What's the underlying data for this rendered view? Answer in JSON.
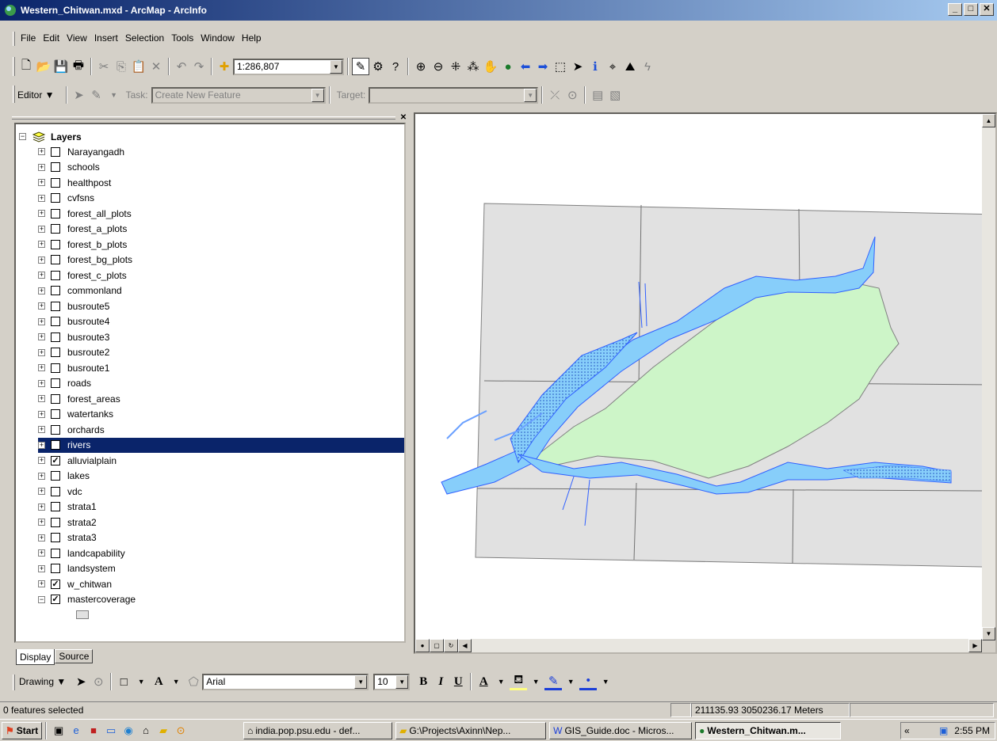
{
  "window": {
    "title": "Western_Chitwan.mxd - ArcMap - ArcInfo",
    "btn_min": "_",
    "btn_max": "□",
    "btn_close": "✕"
  },
  "menu": [
    "File",
    "Edit",
    "View",
    "Insert",
    "Selection",
    "Tools",
    "Window",
    "Help"
  ],
  "standard_toolbar": {
    "scale": "1:286,807"
  },
  "editor_toolbar": {
    "editor_label": "Editor ▼",
    "task_label": "Task:",
    "task_value": "Create New Feature",
    "target_label": "Target:",
    "target_value": ""
  },
  "toc": {
    "root": "Layers",
    "layers": [
      {
        "name": "Narayangadh",
        "checked": false
      },
      {
        "name": "schools",
        "checked": false
      },
      {
        "name": "healthpost",
        "checked": false
      },
      {
        "name": "cvfsns",
        "checked": false
      },
      {
        "name": "forest_all_plots",
        "checked": false
      },
      {
        "name": "forest_a_plots",
        "checked": false
      },
      {
        "name": "forest_b_plots",
        "checked": false
      },
      {
        "name": "forest_bg_plots",
        "checked": false
      },
      {
        "name": "forest_c_plots",
        "checked": false
      },
      {
        "name": "commonland",
        "checked": false
      },
      {
        "name": "busroute5",
        "checked": false
      },
      {
        "name": "busroute4",
        "checked": false
      },
      {
        "name": "busroute3",
        "checked": false
      },
      {
        "name": "busroute2",
        "checked": false
      },
      {
        "name": "busroute1",
        "checked": false
      },
      {
        "name": "roads",
        "checked": false
      },
      {
        "name": "forest_areas",
        "checked": false
      },
      {
        "name": "watertanks",
        "checked": false
      },
      {
        "name": "orchards",
        "checked": false
      },
      {
        "name": "rivers",
        "checked": true,
        "selected": true
      },
      {
        "name": "alluvialplain",
        "checked": true
      },
      {
        "name": "lakes",
        "checked": false
      },
      {
        "name": "vdc",
        "checked": false
      },
      {
        "name": "strata1",
        "checked": false
      },
      {
        "name": "strata2",
        "checked": false
      },
      {
        "name": "strata3",
        "checked": false
      },
      {
        "name": "landcapability",
        "checked": false
      },
      {
        "name": "landsystem",
        "checked": false
      },
      {
        "name": "w_chitwan",
        "checked": true
      },
      {
        "name": "mastercoverage",
        "checked": true,
        "expanded": true
      }
    ],
    "tabs": [
      "Display",
      "Source"
    ]
  },
  "drawing_toolbar": {
    "drawing_label": "Drawing ▼",
    "font": "Arial",
    "size": "10",
    "bold": "B",
    "italic": "I",
    "underline": "U",
    "font_color_label": "A"
  },
  "status": {
    "selected": "0 features selected",
    "coords": "211135.93  3050236.17 Meters"
  },
  "taskbar": {
    "start": "Start",
    "tasks": [
      "india.pop.psu.edu - def...",
      "G:\\Projects\\Axinn\\Nep...",
      "GIS_Guide.doc - Micros...",
      "Western_Chitwan.m..."
    ],
    "clock": "2:55 PM",
    "tray_chevron": "«"
  },
  "colors": {
    "title_start": "#0a246a",
    "title_end": "#a6caf0",
    "selection": "#0a246a",
    "river": "#87cefa",
    "river_stroke": "#3060ff",
    "alluvial": "#cdf5c8",
    "grid_fill": "#e1e1e1"
  }
}
